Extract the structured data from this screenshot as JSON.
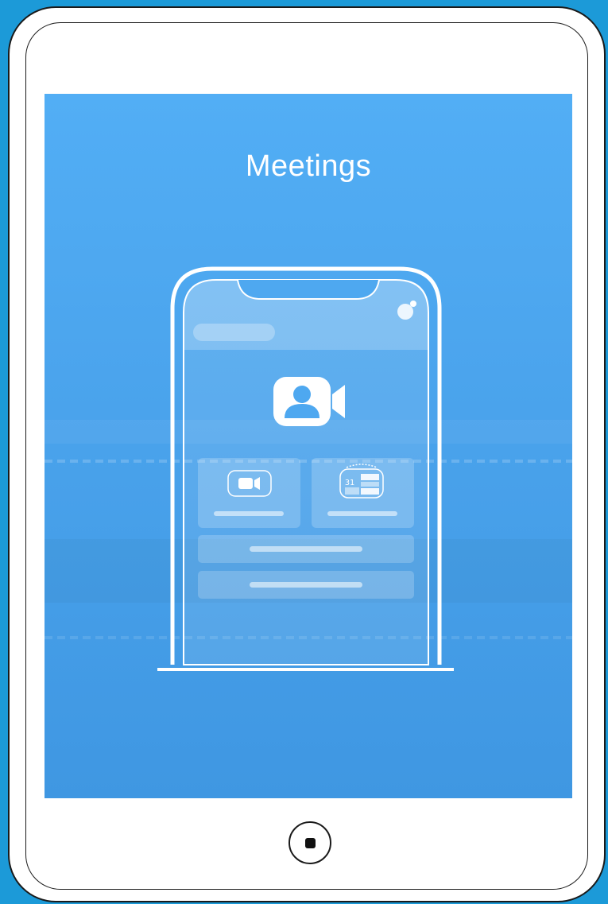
{
  "screen": {
    "title": "Meetings",
    "background_top": "#52aef5",
    "background_bottom": "#3f97e2"
  },
  "illustration": {
    "hero_icon": "video-camera-person-icon",
    "tiles": [
      {
        "icon": "video-camera-icon"
      },
      {
        "icon": "calendar-icon",
        "calendar_day": "31"
      }
    ],
    "list_items": [
      {
        "icon": "none"
      },
      {
        "icon": "none"
      }
    ]
  },
  "device": {
    "home_button_icon": "home-button-icon",
    "frame_color": "#ffffff",
    "outline_color": "#1a1a1a"
  }
}
